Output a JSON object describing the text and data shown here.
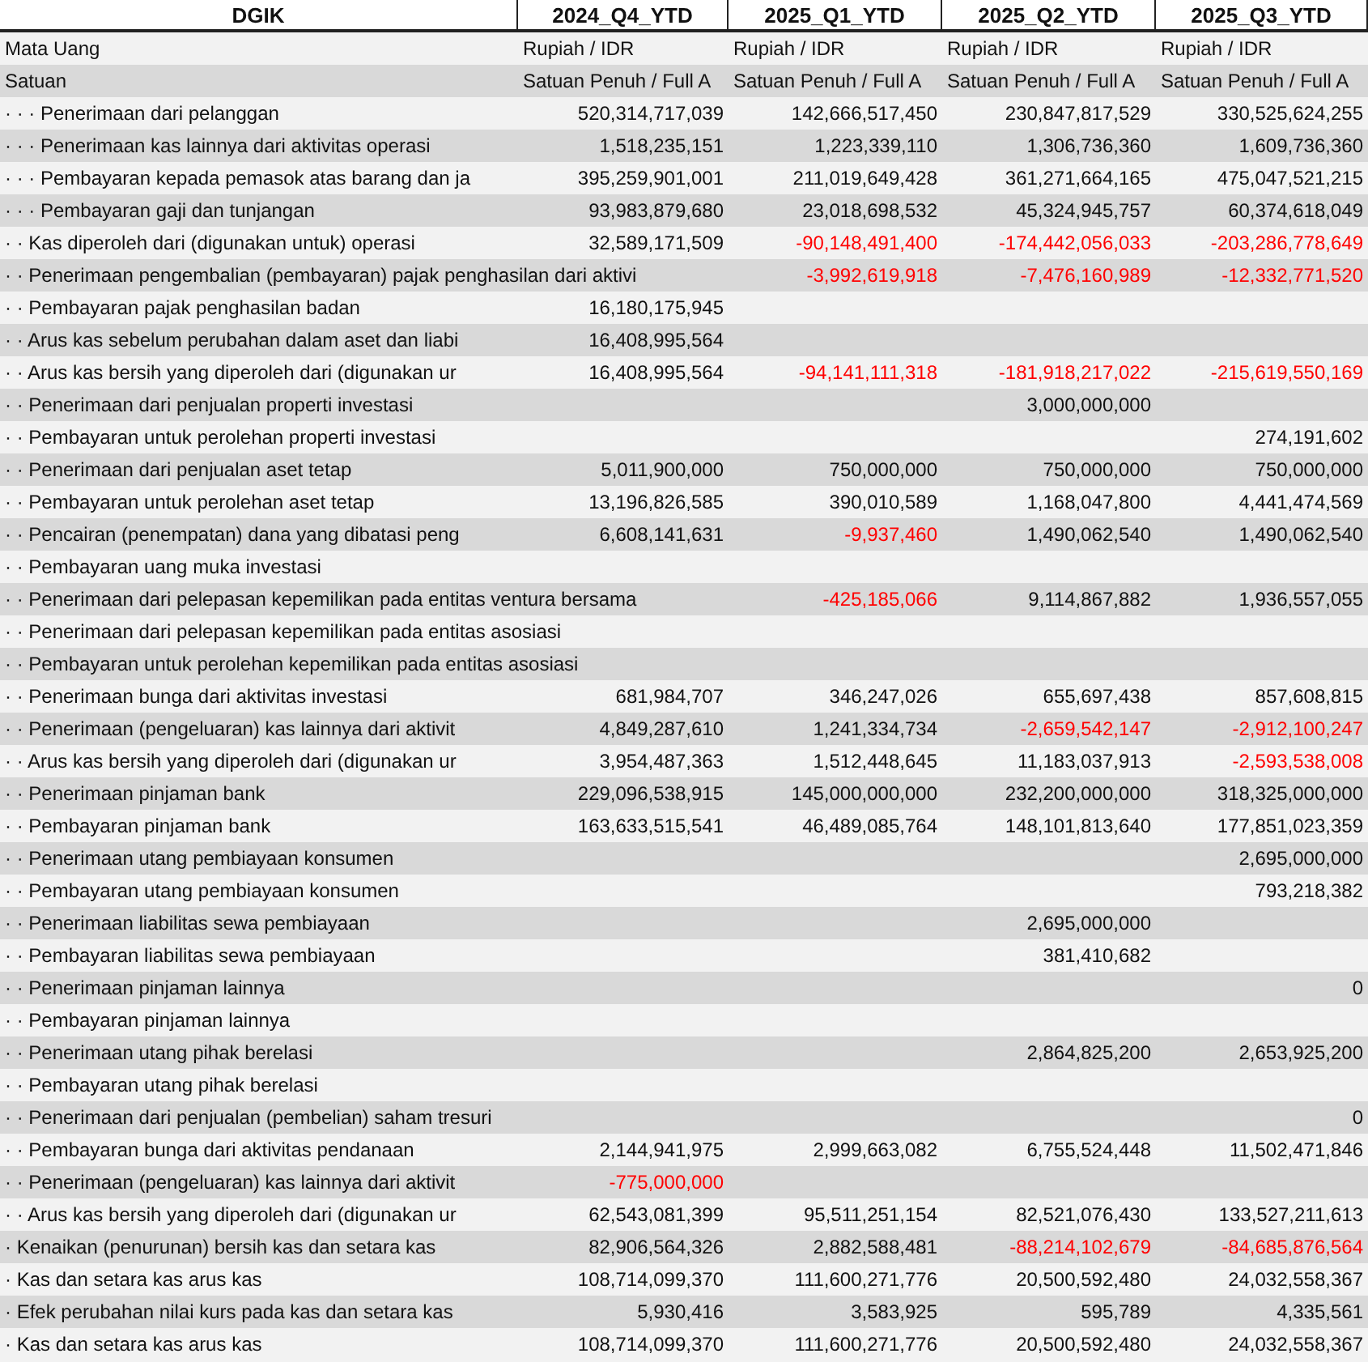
{
  "table": {
    "title": "DGIK",
    "columns": [
      "2024_Q4_YTD",
      "2025_Q1_YTD",
      "2025_Q2_YTD",
      "2025_Q3_YTD"
    ],
    "meta_rows": [
      {
        "label": "Mata Uang",
        "values": [
          "Rupiah / IDR",
          "Rupiah / IDR",
          "Rupiah / IDR",
          "Rupiah / IDR"
        ]
      },
      {
        "label": "Satuan",
        "values": [
          "Satuan Penuh / Full A",
          "Satuan Penuh / Full A",
          "Satuan Penuh / Full A",
          "Satuan Penuh / Full A"
        ]
      }
    ],
    "rows": [
      {
        "label": "· · · Penerimaan dari pelanggan",
        "q4_2024": {
          "value": "520,314,717,039",
          "negative": false
        },
        "q1_2025": {
          "value": "142,666,517,450",
          "negative": false
        },
        "q2_2025": {
          "value": "230,847,817,529",
          "negative": false
        },
        "q3_2025": {
          "value": "330,525,624,255",
          "negative": false
        }
      },
      {
        "label": "· · · Penerimaan kas lainnya dari aktivitas operasi",
        "q4_2024": {
          "value": "1,518,235,151",
          "negative": false
        },
        "q1_2025": {
          "value": "1,223,339,110",
          "negative": false
        },
        "q2_2025": {
          "value": "1,306,736,360",
          "negative": false
        },
        "q3_2025": {
          "value": "1,609,736,360",
          "negative": false
        }
      },
      {
        "label": "· · · Pembayaran kepada pemasok atas barang dan ja",
        "q4_2024": {
          "value": "395,259,901,001",
          "negative": false
        },
        "q1_2025": {
          "value": "211,019,649,428",
          "negative": false
        },
        "q2_2025": {
          "value": "361,271,664,165",
          "negative": false
        },
        "q3_2025": {
          "value": "475,047,521,215",
          "negative": false
        }
      },
      {
        "label": "· · · Pembayaran gaji dan tunjangan",
        "q4_2024": {
          "value": "93,983,879,680",
          "negative": false
        },
        "q1_2025": {
          "value": "23,018,698,532",
          "negative": false
        },
        "q2_2025": {
          "value": "45,324,945,757",
          "negative": false
        },
        "q3_2025": {
          "value": "60,374,618,049",
          "negative": false
        }
      },
      {
        "label": "· · Kas diperoleh dari (digunakan untuk) operasi",
        "q4_2024": {
          "value": "32,589,171,509",
          "negative": false
        },
        "q1_2025": {
          "value": "-90,148,491,400",
          "negative": true
        },
        "q2_2025": {
          "value": "-174,442,056,033",
          "negative": true
        },
        "q3_2025": {
          "value": "-203,286,778,649",
          "negative": true
        }
      },
      {
        "label": "· · Penerimaan pengembalian (pembayaran) pajak penghasilan dari aktivi",
        "q1_2025": {
          "value": "-3,992,619,918",
          "negative": true
        },
        "q2_2025": {
          "value": "-7,476,160,989",
          "negative": true
        },
        "q3_2025": {
          "value": "-12,332,771,520",
          "negative": true
        }
      },
      {
        "label": "· · Pembayaran pajak penghasilan badan",
        "q4_2024": {
          "value": "16,180,175,945",
          "negative": false
        }
      },
      {
        "label": "· · Arus kas sebelum perubahan dalam aset dan liabi",
        "q4_2024": {
          "value": "16,408,995,564",
          "negative": false
        }
      },
      {
        "label": "· · Arus kas bersih yang diperoleh dari (digunakan ur",
        "q4_2024": {
          "value": "16,408,995,564",
          "negative": false
        },
        "q1_2025": {
          "value": "-94,141,111,318",
          "negative": true
        },
        "q2_2025": {
          "value": "-181,918,217,022",
          "negative": true
        },
        "q3_2025": {
          "value": "-215,619,550,169",
          "negative": true
        }
      },
      {
        "label": "· · Penerimaan dari penjualan properti investasi",
        "q2_2025": {
          "value": "3,000,000,000",
          "negative": false
        }
      },
      {
        "label": "· · Pembayaran untuk perolehan properti investasi",
        "q3_2025": {
          "value": "274,191,602",
          "negative": false
        }
      },
      {
        "label": "· · Penerimaan dari penjualan aset tetap",
        "q4_2024": {
          "value": "5,011,900,000",
          "negative": false
        },
        "q1_2025": {
          "value": "750,000,000",
          "negative": false
        },
        "q2_2025": {
          "value": "750,000,000",
          "negative": false
        },
        "q3_2025": {
          "value": "750,000,000",
          "negative": false
        }
      },
      {
        "label": "· · Pembayaran untuk perolehan aset tetap",
        "q4_2024": {
          "value": "13,196,826,585",
          "negative": false
        },
        "q1_2025": {
          "value": "390,010,589",
          "negative": false
        },
        "q2_2025": {
          "value": "1,168,047,800",
          "negative": false
        },
        "q3_2025": {
          "value": "4,441,474,569",
          "negative": false
        }
      },
      {
        "label": "· · Pencairan (penempatan) dana yang dibatasi peng",
        "q4_2024": {
          "value": "6,608,141,631",
          "negative": false
        },
        "q1_2025": {
          "value": "-9,937,460",
          "negative": true
        },
        "q2_2025": {
          "value": "1,490,062,540",
          "negative": false
        },
        "q3_2025": {
          "value": "1,490,062,540",
          "negative": false
        }
      },
      {
        "label": "· · Pembayaran uang muka investasi"
      },
      {
        "label": "· · Penerimaan dari pelepasan kepemilikan pada entitas ventura bersama",
        "q1_2025": {
          "value": "-425,185,066",
          "negative": true
        },
        "q2_2025": {
          "value": "9,114,867,882",
          "negative": false
        },
        "q3_2025": {
          "value": "1,936,557,055",
          "negative": false
        }
      },
      {
        "label": "· · Penerimaan dari pelepasan kepemilikan pada entitas asosiasi"
      },
      {
        "label": "· · Pembayaran untuk perolehan kepemilikan pada entitas asosiasi"
      },
      {
        "label": "· · Penerimaan bunga dari aktivitas investasi",
        "q4_2024": {
          "value": "681,984,707",
          "negative": false
        },
        "q1_2025": {
          "value": "346,247,026",
          "negative": false
        },
        "q2_2025": {
          "value": "655,697,438",
          "negative": false
        },
        "q3_2025": {
          "value": "857,608,815",
          "negative": false
        }
      },
      {
        "label": "· · Penerimaan (pengeluaran) kas lainnya dari aktivit",
        "q4_2024": {
          "value": "4,849,287,610",
          "negative": false
        },
        "q1_2025": {
          "value": "1,241,334,734",
          "negative": false
        },
        "q2_2025": {
          "value": "-2,659,542,147",
          "negative": true
        },
        "q3_2025": {
          "value": "-2,912,100,247",
          "negative": true
        }
      },
      {
        "label": "· · Arus kas bersih yang diperoleh dari (digunakan ur",
        "q4_2024": {
          "value": "3,954,487,363",
          "negative": false
        },
        "q1_2025": {
          "value": "1,512,448,645",
          "negative": false
        },
        "q2_2025": {
          "value": "11,183,037,913",
          "negative": false
        },
        "q3_2025": {
          "value": "-2,593,538,008",
          "negative": true
        }
      },
      {
        "label": "· · Penerimaan pinjaman bank",
        "q4_2024": {
          "value": "229,096,538,915",
          "negative": false
        },
        "q1_2025": {
          "value": "145,000,000,000",
          "negative": false
        },
        "q2_2025": {
          "value": "232,200,000,000",
          "negative": false
        },
        "q3_2025": {
          "value": "318,325,000,000",
          "negative": false
        }
      },
      {
        "label": "· · Pembayaran pinjaman bank",
        "q4_2024": {
          "value": "163,633,515,541",
          "negative": false
        },
        "q1_2025": {
          "value": "46,489,085,764",
          "negative": false
        },
        "q2_2025": {
          "value": "148,101,813,640",
          "negative": false
        },
        "q3_2025": {
          "value": "177,851,023,359",
          "negative": false
        }
      },
      {
        "label": "· · Penerimaan utang pembiayaan konsumen",
        "q3_2025": {
          "value": "2,695,000,000",
          "negative": false
        }
      },
      {
        "label": "· · Pembayaran utang pembiayaan konsumen",
        "q3_2025": {
          "value": "793,218,382",
          "negative": false
        }
      },
      {
        "label": "· · Penerimaan liabilitas sewa pembiayaan",
        "q2_2025": {
          "value": "2,695,000,000",
          "negative": false
        }
      },
      {
        "label": "· · Pembayaran liabilitas sewa pembiayaan",
        "q2_2025": {
          "value": "381,410,682",
          "negative": false
        }
      },
      {
        "label": "· · Penerimaan pinjaman lainnya",
        "q3_2025": {
          "value": "0",
          "negative": false
        }
      },
      {
        "label": "· · Pembayaran pinjaman lainnya"
      },
      {
        "label": "· · Penerimaan utang pihak berelasi",
        "q2_2025": {
          "value": "2,864,825,200",
          "negative": false
        },
        "q3_2025": {
          "value": "2,653,925,200",
          "negative": false
        }
      },
      {
        "label": "· · Pembayaran utang pihak berelasi"
      },
      {
        "label": "· · Penerimaan dari penjualan (pembelian) saham tresuri",
        "q3_2025": {
          "value": "0",
          "negative": false
        }
      },
      {
        "label": "· · Pembayaran bunga dari aktivitas pendanaan",
        "q4_2024": {
          "value": "2,144,941,975",
          "negative": false
        },
        "q1_2025": {
          "value": "2,999,663,082",
          "negative": false
        },
        "q2_2025": {
          "value": "6,755,524,448",
          "negative": false
        },
        "q3_2025": {
          "value": "11,502,471,846",
          "negative": false
        }
      },
      {
        "label": "· · Penerimaan (pengeluaran) kas lainnya dari aktivit",
        "q4_2024": {
          "value": "-775,000,000",
          "negative": true
        }
      },
      {
        "label": "· · Arus kas bersih yang diperoleh dari (digunakan ur",
        "q4_2024": {
          "value": "62,543,081,399",
          "negative": false
        },
        "q1_2025": {
          "value": "95,511,251,154",
          "negative": false
        },
        "q2_2025": {
          "value": "82,521,076,430",
          "negative": false
        },
        "q3_2025": {
          "value": "133,527,211,613",
          "negative": false
        }
      },
      {
        "label": "· Kenaikan (penurunan) bersih kas dan setara kas",
        "q4_2024": {
          "value": "82,906,564,326",
          "negative": false
        },
        "q1_2025": {
          "value": "2,882,588,481",
          "negative": false
        },
        "q2_2025": {
          "value": "-88,214,102,679",
          "negative": true
        },
        "q3_2025": {
          "value": "-84,685,876,564",
          "negative": true
        }
      },
      {
        "label": "· Kas dan setara kas arus kas",
        "q4_2024": {
          "value": "108,714,099,370",
          "negative": false
        },
        "q1_2025": {
          "value": "111,600,271,776",
          "negative": false
        },
        "q2_2025": {
          "value": "20,500,592,480",
          "negative": false
        },
        "q3_2025": {
          "value": "24,032,558,367",
          "negative": false
        }
      },
      {
        "label": "· Efek perubahan nilai kurs pada kas dan setara kas",
        "q4_2024": {
          "value": "5,930,416",
          "negative": false
        },
        "q1_2025": {
          "value": "3,583,925",
          "negative": false
        },
        "q2_2025": {
          "value": "595,789",
          "negative": false
        },
        "q3_2025": {
          "value": "4,335,561",
          "negative": false
        }
      },
      {
        "label": "· Kas dan setara kas arus kas",
        "q4_2024": {
          "value": "108,714,099,370",
          "negative": false
        },
        "q1_2025": {
          "value": "111,600,271,776",
          "negative": false
        },
        "q2_2025": {
          "value": "20,500,592,480",
          "negative": false
        },
        "q3_2025": {
          "value": "24,032,558,367",
          "negative": false
        }
      }
    ]
  }
}
